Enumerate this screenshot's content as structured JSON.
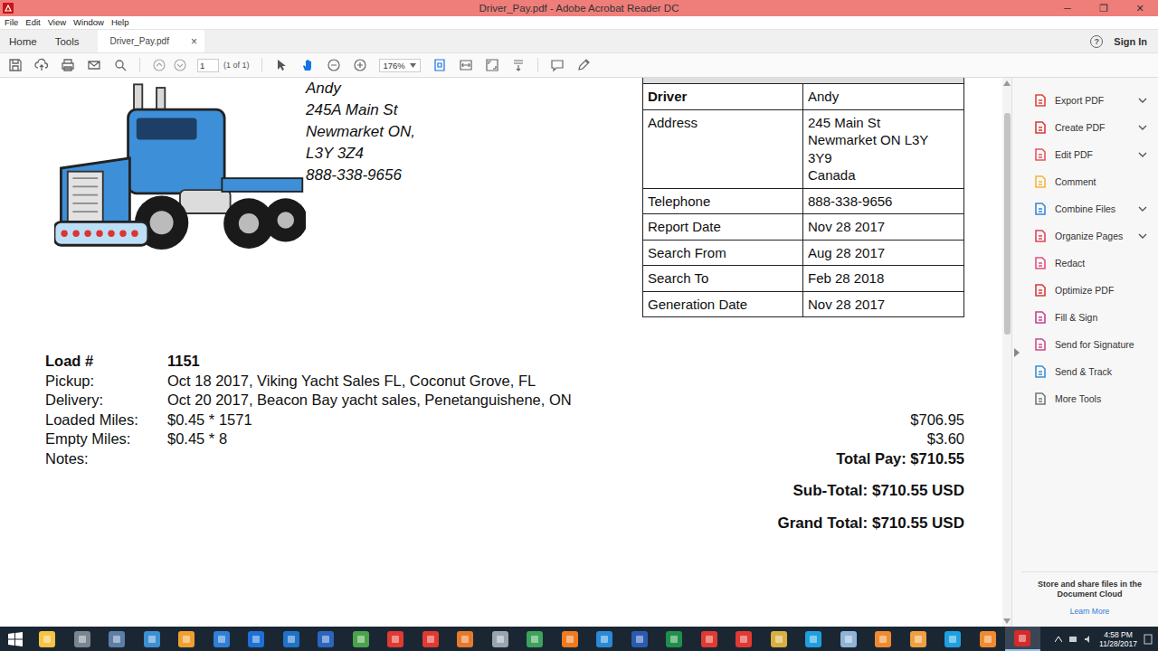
{
  "window": {
    "title": "Driver_Pay.pdf - Adobe Acrobat Reader DC",
    "controls": [
      "─",
      "❐",
      "✕"
    ]
  },
  "menu": [
    "File",
    "Edit",
    "View",
    "Window",
    "Help"
  ],
  "nav": [
    {
      "label": "Home"
    },
    {
      "label": "Tools"
    }
  ],
  "tab": {
    "label": "Driver_Pay.pdf",
    "close": "×",
    "selected": true
  },
  "help": "?",
  "sign_in": "Sign In",
  "toolbar": {
    "page": "1",
    "page_count": "(1 of 1)",
    "zoom": "176%",
    "pointer_tools": [
      {
        "selected": false
      },
      {
        "selected": true
      }
    ]
  },
  "document": {
    "header_address": [
      "Andy",
      "245A Main St",
      "Newmarket ON,",
      "L3Y 3Z4",
      "888-338-9656"
    ],
    "info": [
      {
        "label": "Driver",
        "value": [
          "Andy"
        ]
      },
      {
        "label": "Address",
        "value": [
          "245 Main St",
          "Newmarket ON L3Y",
          "3Y9",
          "Canada"
        ]
      },
      {
        "label": "Telephone",
        "value": [
          "888-338-9656"
        ]
      },
      {
        "label": "Report Date",
        "value": [
          "Nov 28 2017"
        ]
      },
      {
        "label": "Search From",
        "value": [
          "Aug 28 2017"
        ]
      },
      {
        "label": "Search To",
        "value": [
          "Feb 28 2018"
        ]
      },
      {
        "label": "Generation Date",
        "value": [
          "Nov 28 2017"
        ]
      }
    ],
    "load": {
      "label": "Load #",
      "number": "1151"
    },
    "stops": [
      {
        "label": "Pickup:",
        "value": "Oct 18 2017, Viking Yacht Sales FL, Coconut Grove, FL"
      },
      {
        "label": "Delivery:",
        "value": "Oct 20 2017, Beacon Bay yacht sales, Penetanguishene, ON"
      }
    ],
    "charges": [
      {
        "label": "Loaded Miles:",
        "rate": "$0.45 * 1571",
        "amount": "$706.95"
      },
      {
        "label": "Empty Miles:",
        "rate": "$0.45 * 8",
        "amount": "$3.60"
      }
    ],
    "notes": {
      "label": "Notes:"
    },
    "total_pay": "Total Pay: $710.55",
    "sub_total": "Sub-Total: $710.55 USD",
    "grand_total": "Grand Total: $710.55 USD"
  },
  "tools_panel": {
    "items": [
      {
        "label": "Export PDF",
        "expandable": true,
        "color": "#e0463c"
      },
      {
        "label": "Create PDF",
        "expandable": true,
        "color": "#d93a3a"
      },
      {
        "label": "Edit PDF",
        "expandable": true,
        "color": "#e8545e"
      },
      {
        "label": "Comment",
        "expandable": false,
        "color": "#f5b73b"
      },
      {
        "label": "Combine Files",
        "expandable": true,
        "color": "#3a87d6"
      },
      {
        "label": "Organize Pages",
        "expandable": true,
        "color": "#e0435a"
      },
      {
        "label": "Redact",
        "expandable": false,
        "color": "#e15079"
      },
      {
        "label": "Optimize PDF",
        "expandable": false,
        "color": "#d93a3a"
      },
      {
        "label": "Fill & Sign",
        "expandable": false,
        "color": "#c2448e"
      },
      {
        "label": "Send for Signature",
        "expandable": false,
        "color": "#d04a8a"
      },
      {
        "label": "Send & Track",
        "expandable": false,
        "color": "#3b8fd4"
      },
      {
        "label": "More Tools",
        "expandable": false,
        "color": "#777777"
      }
    ]
  },
  "cloud_promo": {
    "text": "Store and share files in the Document Cloud",
    "link": "Learn More"
  },
  "taskbar": {
    "time": "4:58 PM",
    "date": "11/28/2017",
    "apps": [
      {
        "color": "#f6c343",
        "active": false
      },
      {
        "color": "#7a8590",
        "active": false
      },
      {
        "color": "#5b7fa8",
        "active": false
      },
      {
        "color": "#3c8fd0",
        "active": false
      },
      {
        "color": "#f0a030",
        "active": false
      },
      {
        "color": "#2f7fd6",
        "active": false
      },
      {
        "color": "#1e6fd6",
        "active": false
      },
      {
        "color": "#1e73c8",
        "active": false
      },
      {
        "color": "#2a66c0",
        "active": false
      },
      {
        "color": "#4aa24a",
        "active": false
      },
      {
        "color": "#e03a32",
        "active": false
      },
      {
        "color": "#e03a32",
        "active": false
      },
      {
        "color": "#e8792a",
        "active": false
      },
      {
        "color": "#9aa4ad",
        "active": false
      },
      {
        "color": "#3ca35a",
        "active": false
      },
      {
        "color": "#f07a20",
        "active": false
      },
      {
        "color": "#2a8ad8",
        "active": false
      },
      {
        "color": "#2b5bb0",
        "active": false
      },
      {
        "color": "#1f8f4a",
        "active": false
      },
      {
        "color": "#e03a32",
        "active": false
      },
      {
        "color": "#e03a32",
        "active": false
      },
      {
        "color": "#d8b040",
        "active": false
      },
      {
        "color": "#1ea0e0",
        "active": false
      },
      {
        "color": "#8fb4d8",
        "active": false
      },
      {
        "color": "#f08a30",
        "active": false
      },
      {
        "color": "#f0a040",
        "active": false
      },
      {
        "color": "#1ea0e0",
        "active": false
      },
      {
        "color": "#f08a30",
        "active": false
      },
      {
        "color": "#d42a2a",
        "active": true
      }
    ]
  }
}
